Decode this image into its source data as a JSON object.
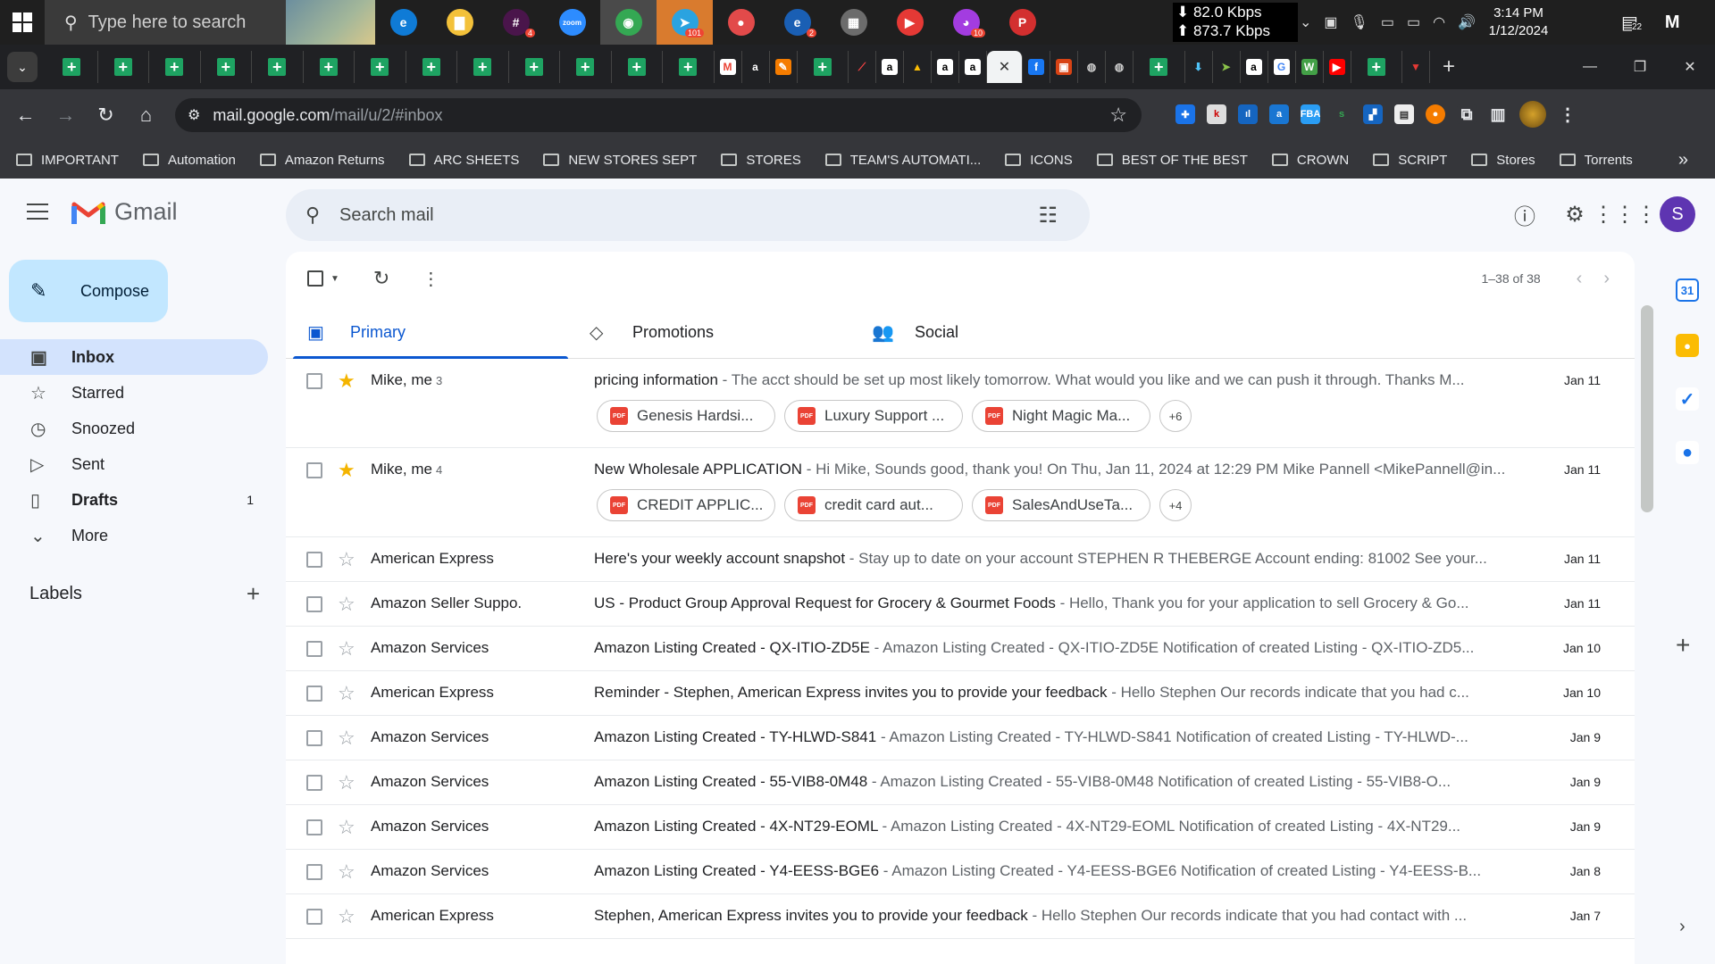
{
  "taskbar": {
    "search_placeholder": "Type here to search",
    "net_down": "⬇ 82.0 Kbps",
    "net_up": "⬆ 873.7 Kbps",
    "time": "3:14 PM",
    "date": "1/12/2024",
    "notif_count": "22",
    "apps": [
      {
        "name": "edge-icon",
        "glyph": "e",
        "color": "#0f7bd6"
      },
      {
        "name": "file-explorer-icon",
        "glyph": "▇",
        "color": "#f3c13a"
      },
      {
        "name": "slack-icon",
        "glyph": "#",
        "color": "#4a154b",
        "badge": "4"
      },
      {
        "name": "zoom-icon",
        "glyph": "zoom",
        "color": "#2d8cff"
      },
      {
        "name": "chrome-icon",
        "glyph": "◉",
        "color": "#34a853",
        "active": true
      },
      {
        "name": "telegram-icon",
        "glyph": "➤",
        "color": "#2aa3e0",
        "orange": true,
        "badge": "101"
      },
      {
        "name": "app-red-dots-icon",
        "glyph": "●",
        "color": "#e24a4a"
      },
      {
        "name": "edge-profile-icon",
        "glyph": "e",
        "color": "#1a5fb4",
        "badge": "2"
      },
      {
        "name": "calculator-icon",
        "glyph": "▦",
        "color": "#6c6c6c"
      },
      {
        "name": "media-player-icon",
        "glyph": "▶",
        "color": "#e53935"
      },
      {
        "name": "messenger-icon",
        "glyph": "◕",
        "color": "#a33ce0",
        "badge": "10"
      },
      {
        "name": "pinterest-icon",
        "glyph": "P",
        "color": "#d32f2f"
      }
    ]
  },
  "browser": {
    "url_host": "mail.google.com",
    "url_path": "/mail/u/2/#inbox",
    "bookmarks": [
      "IMPORTANT",
      "Automation",
      "Amazon Returns",
      "ARC SHEETS",
      "NEW STORES SEPT",
      "STORES",
      "TEAM'S AUTOMATI...",
      "ICONS",
      "BEST OF THE BEST",
      "CROWN",
      "SCRIPT",
      "Stores",
      "Torrents"
    ]
  },
  "gmail": {
    "logo_text": "Gmail",
    "search_placeholder": "Search mail",
    "avatar_letter": "S",
    "compose_label": "Compose",
    "nav": [
      {
        "name": "inbox",
        "label": "Inbox",
        "icon": "▣",
        "active": true,
        "count": ""
      },
      {
        "name": "starred",
        "label": "Starred",
        "icon": "☆",
        "active": false,
        "count": ""
      },
      {
        "name": "snoozed",
        "label": "Snoozed",
        "icon": "◷",
        "active": false,
        "count": ""
      },
      {
        "name": "sent",
        "label": "Sent",
        "icon": "▷",
        "active": false,
        "count": ""
      },
      {
        "name": "drafts",
        "label": "Drafts",
        "icon": "▯",
        "active": false,
        "count": "1",
        "bold": true
      },
      {
        "name": "more",
        "label": "More",
        "icon": "⌄",
        "active": false,
        "count": ""
      }
    ],
    "labels_title": "Labels",
    "pager": "1–38 of 38",
    "tabs": [
      {
        "name": "primary",
        "label": "Primary",
        "icon": "▣",
        "active": true
      },
      {
        "name": "promotions",
        "label": "Promotions",
        "icon": "◇",
        "active": false
      },
      {
        "name": "social",
        "label": "Social",
        "icon": "👥",
        "active": false
      }
    ],
    "emails": [
      {
        "sender": "Mike, me",
        "count": "3",
        "starred": true,
        "subject": "pricing information",
        "snippet": " - The acct should be set up most likely tomorrow. What would you like and we can push it through. Thanks M...",
        "date": "Jan 11",
        "attachments": [
          "Genesis Hardsi...",
          "Luxury Support ...",
          "Night Magic Ma..."
        ],
        "more": "+6"
      },
      {
        "sender": "Mike, me",
        "count": "4",
        "starred": true,
        "subject": "New Wholesale APPLICATION",
        "snippet": " - Hi Mike, Sounds good, thank you! On Thu, Jan 11, 2024 at 12:29 PM Mike Pannell <MikePannell@in...",
        "date": "Jan 11",
        "attachments": [
          "CREDIT APPLIC...",
          "credit card aut...",
          "SalesAndUseTa..."
        ],
        "more": "+4"
      },
      {
        "sender": "American Express",
        "count": "",
        "starred": false,
        "subject": "Here's your weekly account snapshot",
        "snippet": " - Stay up to date on your account STEPHEN R THEBERGE Account ending: 81002 See your...",
        "date": "Jan 11"
      },
      {
        "sender": "Amazon Seller Suppo.",
        "count": "",
        "starred": false,
        "subject": "US - Product Group Approval Request for Grocery & Gourmet Foods",
        "snippet": " - Hello, Thank you for your application to sell Grocery & Go...",
        "date": "Jan 11"
      },
      {
        "sender": "Amazon Services",
        "count": "",
        "starred": false,
        "subject": "Amazon Listing Created - QX-ITIO-ZD5E",
        "snippet": " - Amazon Listing Created - QX-ITIO-ZD5E Notification of created Listing - QX-ITIO-ZD5...",
        "date": "Jan 10"
      },
      {
        "sender": "American Express",
        "count": "",
        "starred": false,
        "subject": "Reminder - Stephen, American Express invites you to provide your feedback",
        "snippet": " - Hello Stephen Our records indicate that you had c...",
        "date": "Jan 10"
      },
      {
        "sender": "Amazon Services",
        "count": "",
        "starred": false,
        "subject": "Amazon Listing Created - TY-HLWD-S841",
        "snippet": " - Amazon Listing Created - TY-HLWD-S841 Notification of created Listing - TY-HLWD-...",
        "date": "Jan 9"
      },
      {
        "sender": "Amazon Services",
        "count": "",
        "starred": false,
        "subject": "Amazon Listing Created - 55-VIB8-0M48",
        "snippet": " - Amazon Listing Created - 55-VIB8-0M48 Notification of created Listing - 55-VIB8-O...",
        "date": "Jan 9"
      },
      {
        "sender": "Amazon Services",
        "count": "",
        "starred": false,
        "subject": "Amazon Listing Created - 4X-NT29-EOML",
        "snippet": " - Amazon Listing Created - 4X-NT29-EOML Notification of created Listing - 4X-NT29...",
        "date": "Jan 9"
      },
      {
        "sender": "Amazon Services",
        "count": "",
        "starred": false,
        "subject": "Amazon Listing Created - Y4-EESS-BGE6",
        "snippet": " - Amazon Listing Created - Y4-EESS-BGE6 Notification of created Listing - Y4-EESS-B...",
        "date": "Jan 8"
      },
      {
        "sender": "American Express",
        "count": "",
        "starred": false,
        "subject": "Stephen, American Express invites you to provide your feedback",
        "snippet": " - Hello Stephen Our records indicate that you had contact with ...",
        "date": "Jan 7"
      }
    ]
  },
  "colors": {
    "accent": "#0b57d0",
    "compose_bg": "#c2e7ff",
    "active_nav": "#d3e3fd",
    "star_on": "#f4b400",
    "pdf_red": "#ea4335"
  }
}
